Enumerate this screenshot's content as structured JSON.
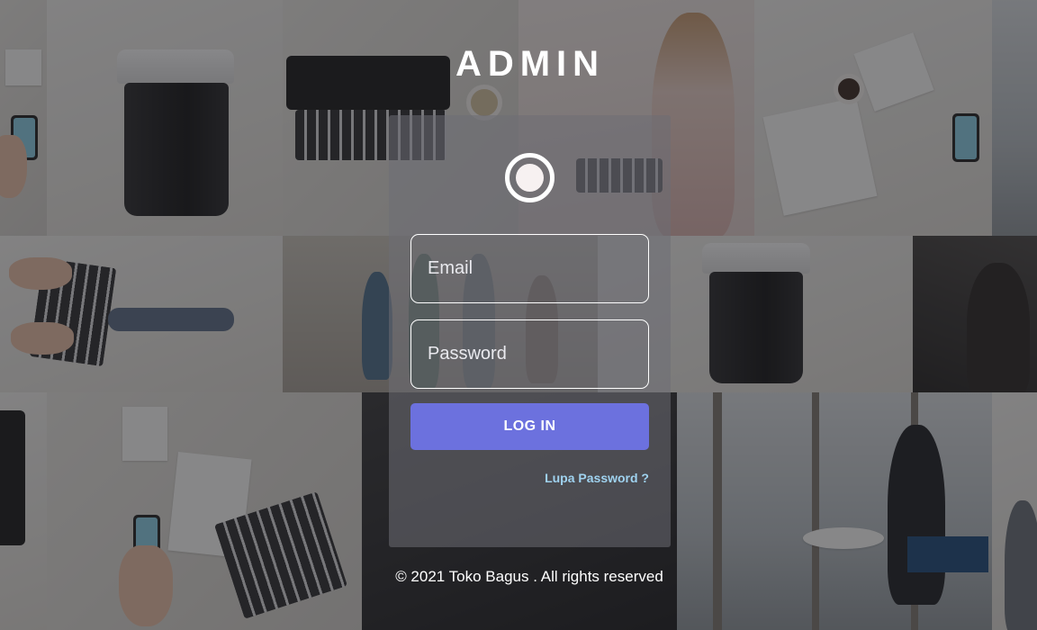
{
  "page": {
    "title": "ADMIN"
  },
  "login": {
    "email_placeholder": "Email",
    "password_placeholder": "Password",
    "login_label": "LOG IN",
    "forgot_label": "Lupa Password ?"
  },
  "footer": {
    "text": "© 2021 Toko Bagus . All rights reserved"
  },
  "colors": {
    "button": "#6c71de",
    "link": "#9fd2ef",
    "card": "rgba(110,110,116,0.55)"
  },
  "icons": {
    "logo": "ring-dot-icon"
  }
}
